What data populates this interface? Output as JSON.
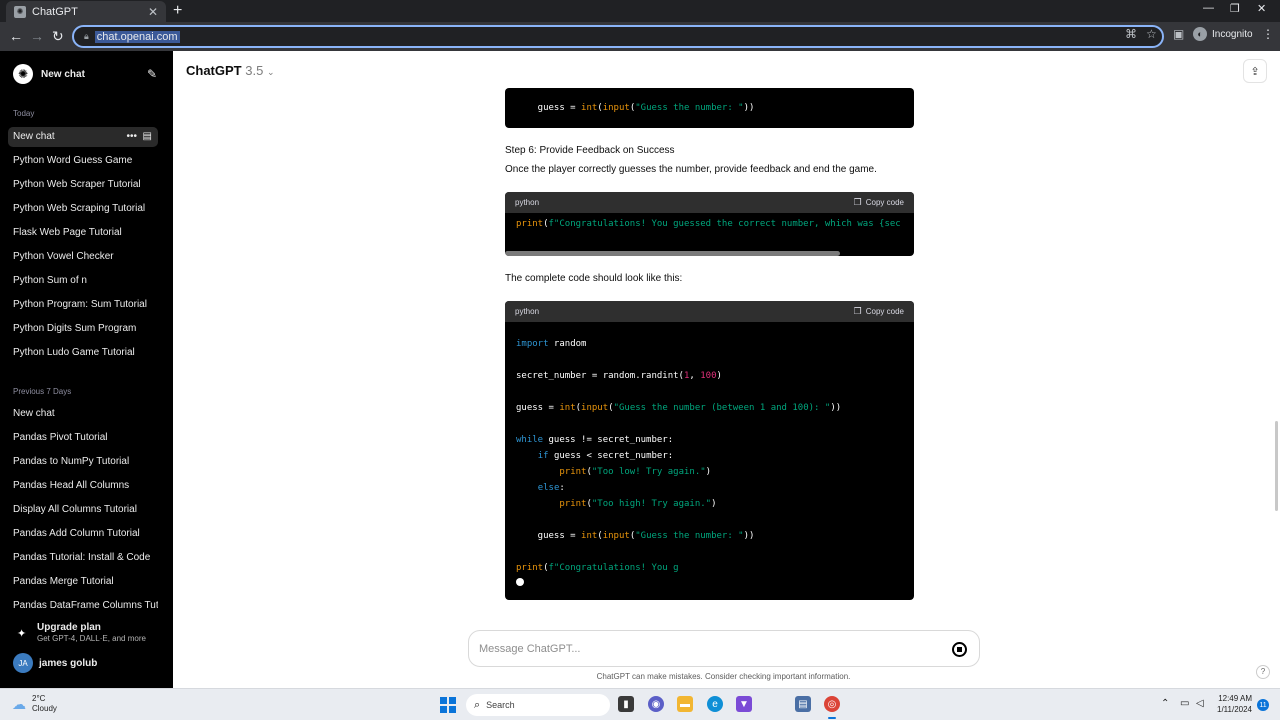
{
  "browser": {
    "tab_title": "ChatGPT",
    "url": "chat.openai.com",
    "incognito_label": "Incognito"
  },
  "sidebar": {
    "new_chat_label": "New chat",
    "section_today": "Today",
    "today_items": [
      "New chat",
      "Python Word Guess Game",
      "Python Web Scraper Tutorial",
      "Python Web Scraping Tutorial",
      "Flask Web Page Tutorial",
      "Python Vowel Checker",
      "Python Sum of n",
      "Python Program: Sum Tutorial",
      "Python Digits Sum Program",
      "Python Ludo Game Tutorial"
    ],
    "section_prev": "Previous 7 Days",
    "prev_items": [
      "New chat",
      "Pandas Pivot Tutorial",
      "Pandas to NumPy Tutorial",
      "Pandas Head All Columns",
      "Display All Columns Tutorial",
      "Pandas Add Column Tutorial",
      "Pandas Tutorial: Install & Code",
      "Pandas Merge Tutorial",
      "Pandas DataFrame Columns Tuto"
    ],
    "upgrade_title": "Upgrade plan",
    "upgrade_sub": "Get GPT-4, DALL·E, and more",
    "user_initials": "JA",
    "user_name": "james golub"
  },
  "header": {
    "model_name": "ChatGPT",
    "model_version": "3.5"
  },
  "content": {
    "code1_line": "    guess = int(input(\"Guess the number: \"))",
    "step6_heading": "Step 6: Provide Feedback on Success",
    "step6_text": "Once the player correctly guesses the number, provide feedback and end the game.",
    "code_lang": "python",
    "copy_label": "Copy code",
    "code2_line": "print(f\"Congratulations! You guessed the correct number, which was {sec",
    "complete_text": "The complete code should look like this:",
    "code3_partial": "print(f\"Congratulations! You g"
  },
  "composer": {
    "placeholder": "Message ChatGPT...",
    "disclaimer": "ChatGPT can make mistakes. Consider checking important information.",
    "help": "?"
  },
  "taskbar": {
    "temp": "2°C",
    "weather": "Cloudy",
    "search_label": "Search",
    "time": "12:49 AM",
    "date": "1/11/2024",
    "notif_count": "11"
  }
}
